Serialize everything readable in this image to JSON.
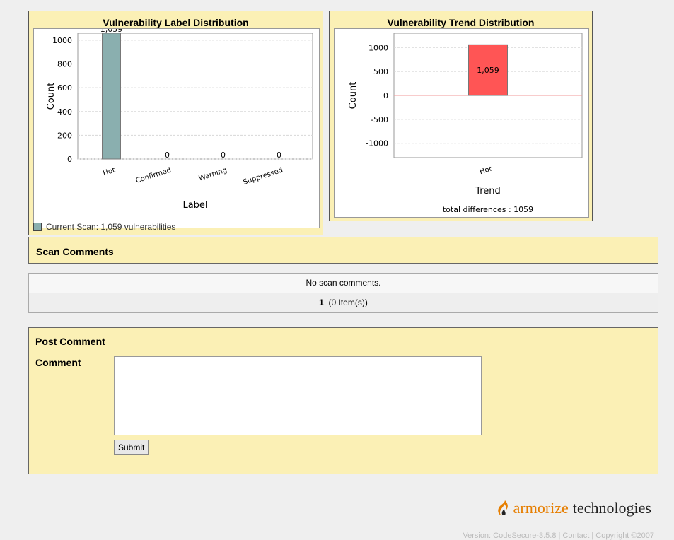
{
  "label_chart": {
    "title": "Vulnerability Label Distribution",
    "legend": "Current Scan: 1,059 vulnerabilities",
    "bar_color": "#8aafaf"
  },
  "trend_chart": {
    "title": "Vulnerability Trend Distribution",
    "total": "total differences : 1059",
    "bar_color": "#ff5555"
  },
  "chart_data": [
    {
      "type": "bar",
      "title": "Vulnerability Label Distribution",
      "xlabel": "Label",
      "ylabel": "Count",
      "categories": [
        "Hot",
        "Confirmed",
        "Warning",
        "Suppressed"
      ],
      "values": [
        1059,
        0,
        0,
        0
      ],
      "value_labels": [
        "1,059",
        "0",
        "0",
        "0"
      ],
      "ylim": [
        0,
        1059
      ],
      "yticks": [
        0,
        200,
        400,
        600,
        800,
        1000
      ],
      "legend": "Current Scan: 1,059 vulnerabilities",
      "grid": true
    },
    {
      "type": "bar",
      "title": "Vulnerability Trend Distribution",
      "xlabel": "Trend",
      "ylabel": "Count",
      "categories": [
        "Hot"
      ],
      "values": [
        1059
      ],
      "value_labels": [
        "1,059"
      ],
      "ylim": [
        -1300,
        1300
      ],
      "yticks": [
        -1000,
        -500,
        0,
        500,
        1000
      ],
      "grid": true
    }
  ],
  "scan_comments": {
    "title": "Scan Comments",
    "empty_text": "No scan comments.",
    "page_number": "1",
    "item_count": "(0 Item(s))"
  },
  "post_comment": {
    "title": "Post Comment",
    "comment_label": "Comment",
    "comment_value": "",
    "submit_label": "Submit"
  },
  "branding": {
    "logo_accent": "armorize",
    "logo_rest": "technologies",
    "footer": "Version: CodeSecure-3.5.8 | Contact | Copyright ©2007"
  }
}
